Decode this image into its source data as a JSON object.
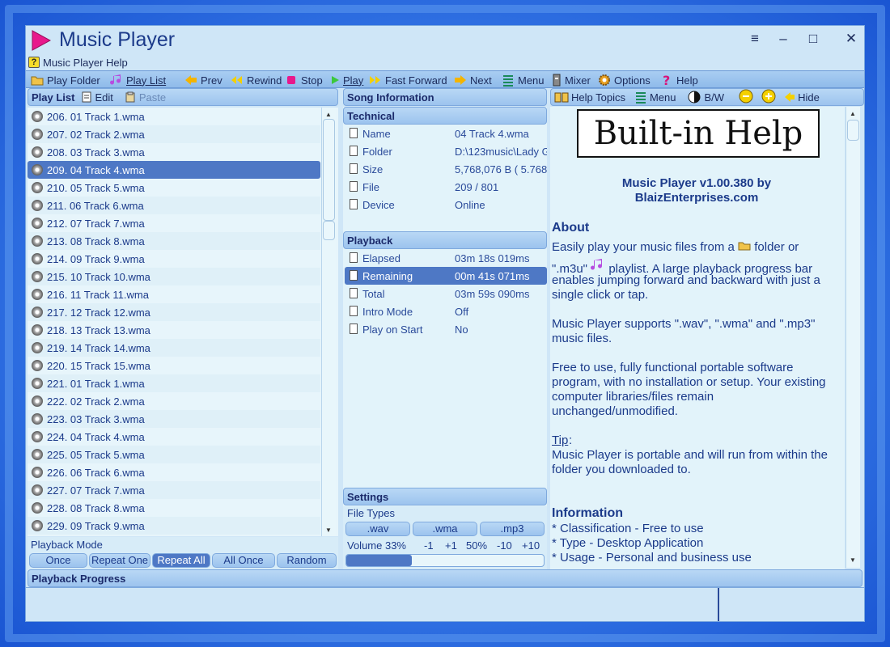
{
  "app": {
    "title": "Music Player",
    "help_menu": "Music Player Help"
  },
  "window_controls": {
    "menu": "≡",
    "minimize": "‒",
    "maximize": "□",
    "close": "✕"
  },
  "toolbar": {
    "play_folder": "Play Folder",
    "play_list": "Play List",
    "prev": "Prev",
    "rewind": "Rewind",
    "stop": "Stop",
    "play": "Play",
    "fast_forward": "Fast Forward",
    "next": "Next",
    "menu": "Menu",
    "mixer": "Mixer",
    "options": "Options",
    "help": "Help"
  },
  "playlist": {
    "header": "Play List",
    "edit": "Edit",
    "paste": "Paste",
    "items": [
      "206. 01 Track 1.wma",
      "207. 02 Track 2.wma",
      "208. 03 Track 3.wma",
      "209. 04 Track 4.wma",
      "210. 05 Track 5.wma",
      "211. 06 Track 6.wma",
      "212. 07 Track 7.wma",
      "213. 08 Track 8.wma",
      "214. 09 Track 9.wma",
      "215. 10 Track 10.wma",
      "216. 11 Track 11.wma",
      "217. 12 Track 12.wma",
      "218. 13 Track 13.wma",
      "219. 14 Track 14.wma",
      "220. 15 Track 15.wma",
      "221. 01 Track 1.wma",
      "222. 02 Track 2.wma",
      "223. 03 Track 3.wma",
      "224. 04 Track 4.wma",
      "225. 05 Track 5.wma",
      "226. 06 Track 6.wma",
      "227. 07 Track 7.wma",
      "228. 08 Track 8.wma",
      "229. 09 Track 9.wma"
    ],
    "selected_index": 3
  },
  "playback_mode": {
    "label": "Playback Mode",
    "options": [
      "Once",
      "Repeat One",
      "Repeat All",
      "All Once",
      "Random"
    ],
    "selected": "Repeat All"
  },
  "song_info": {
    "header": "Song Information",
    "technical_header": "Technical",
    "technical": [
      {
        "k": "Name",
        "v": "04 Track 4.wma"
      },
      {
        "k": "Folder",
        "v": "D:\\123music\\Lady G"
      },
      {
        "k": "Size",
        "v": "5,768,076 B  ( 5.768"
      },
      {
        "k": "File",
        "v": "209 / 801"
      },
      {
        "k": "Device",
        "v": "Online"
      }
    ],
    "playback_header": "Playback",
    "playback": [
      {
        "k": "Elapsed",
        "v": "03m 18s 019ms"
      },
      {
        "k": "Remaining",
        "v": "00m 41s 071ms"
      },
      {
        "k": "Total",
        "v": "03m 59s 090ms"
      },
      {
        "k": "Intro Mode",
        "v": "Off"
      },
      {
        "k": "Play on Start",
        "v": "No"
      }
    ],
    "playback_selected": 1
  },
  "settings": {
    "header": "Settings",
    "file_types_label": "File Types",
    "file_types": [
      ".wav",
      ".wma",
      ".mp3"
    ],
    "volume_label": "Volume 33%",
    "volume_fraction": 0.33,
    "volume_buttons": [
      "-1",
      "+1",
      "50%",
      "-10",
      "+10"
    ]
  },
  "help_pane": {
    "help_topics": "Help Topics",
    "menu": "Menu",
    "bw": "B/W",
    "hide": "Hide",
    "banner": "Built-in Help",
    "version_line1": "Music Player v1.00.380 by",
    "version_line2": "BlaizEnterprises.com",
    "about_heading": "About",
    "about_1a": "Easily play your music files from a",
    "about_1b": "folder or",
    "about_2a": "\".m3u\"",
    "about_2b": "playlist.  A large playback progress bar",
    "about_3": "enables jumping forward and backward with just a",
    "about_4": "single click or tap.",
    "supports_1": "Music Player supports \".wav\", \".wma\" and \".mp3\"",
    "supports_2": "music files.",
    "free_1": "Free to use, fully functional portable software",
    "free_2": "program, with no installation or setup.  Your existing",
    "free_3": "computer libraries/files remain",
    "free_4": "unchanged/unmodified.",
    "tip_label": "Tip",
    "tip_1": "Music Player is portable and will run from within the",
    "tip_2": "folder you downloaded to.",
    "info_heading": "Information",
    "info_1": "* Classification - Free to use",
    "info_2": "* Type - Desktop Application",
    "info_3": "* Usage - Personal and business use"
  },
  "progress": {
    "label": "Playback Progress"
  }
}
